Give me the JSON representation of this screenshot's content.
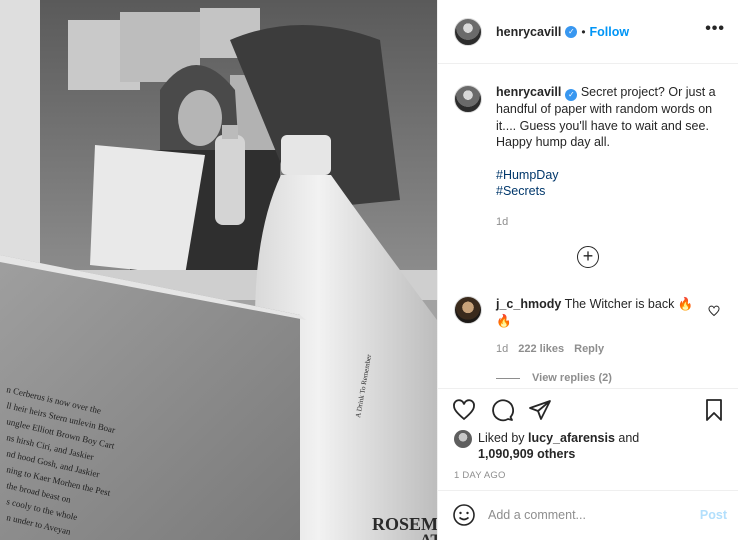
{
  "header": {
    "username": "henrycavill",
    "separator": "•",
    "follow_label": "Follow",
    "more_label": "•••"
  },
  "caption": {
    "username": "henrycavill",
    "text": "Secret project? Or just a handful of paper with random words on it.... Guess you'll have to wait and see. Happy hump day all.",
    "hashtags": [
      "#HumpDay",
      "#Secrets"
    ],
    "time": "1d"
  },
  "load_more_label": "+",
  "comment": {
    "username": "j_c_hmody",
    "text": "The Witcher is back 🔥🔥",
    "time": "1d",
    "likes": "222 likes",
    "reply_label": "Reply",
    "view_replies": "View replies (2)"
  },
  "likes": {
    "prefix": "Liked by",
    "user": "lucy_afarensis",
    "joiner": "and",
    "others": "1,090,909 others"
  },
  "posted_ago": "1 DAY AGO",
  "add_comment": {
    "placeholder": "Add a comment...",
    "post_label": "Post"
  },
  "photo": {
    "book_text": [
      "n Cerberus is now over the",
      "ll heir heirs Stern unlevin Boar",
      "unglee Elliott Brown Boy Cart",
      "ns hirsh Ciri, and Jaskier",
      "nd hood Gosh, and Jaskier",
      "ning to Kaer Morhen the Pest",
      "the broad beast on",
      "s cooly to the whole",
      "n under to Aveyan"
    ],
    "bottle_label_line1": "A Drink To Remember",
    "bottle_label_line2": "ROSEMA",
    "bottle_label_line3": "ATE"
  },
  "colors": {
    "accent": "#0095f6",
    "verified": "#3897f0",
    "hashtag": "#00376b",
    "muted": "#8e8e8e",
    "post_disabled": "#b2dffc"
  }
}
